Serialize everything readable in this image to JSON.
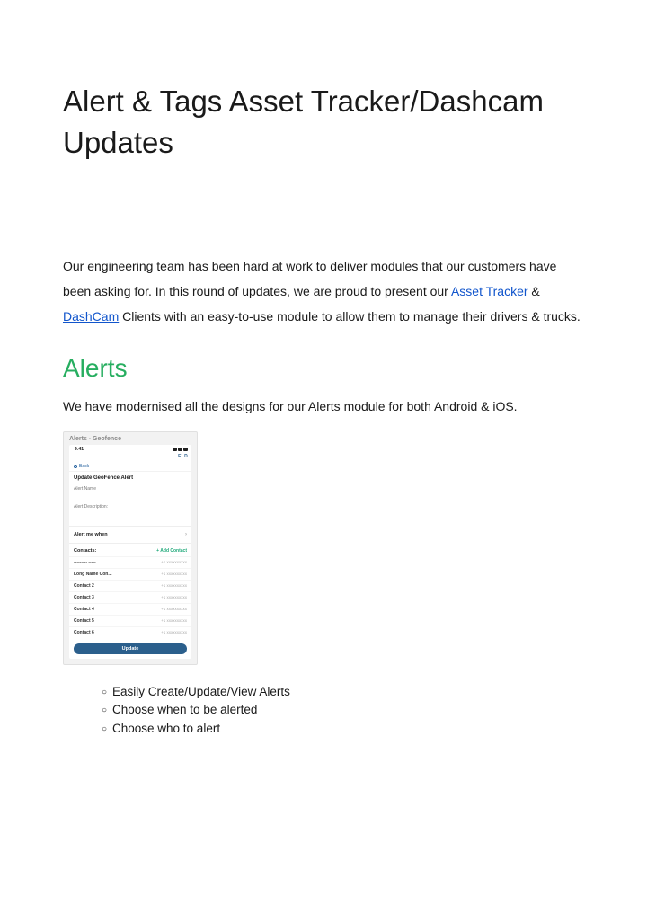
{
  "title": "Alert & Tags Asset Tracker/Dashcam Updates",
  "intro": {
    "part1": "Our engineering team has been hard at work to deliver modules that our customers have been asking for. In this round of updates, we are proud to present our",
    "link1": " Asset Tracker",
    "amp": " & ",
    "link2": "DashCam",
    "part2": " Clients with an easy-to-use module to allow them to manage their drivers & trucks."
  },
  "section": {
    "heading": "Alerts",
    "text": "We have modernised all the designs for our Alerts module for both Android & iOS."
  },
  "mockup": {
    "header": "Alerts - Geofence",
    "time": "9:41",
    "brand": "ELD",
    "back": "Back",
    "screen_title": "Update GeoFence Alert",
    "field_name": "Alert Name",
    "field_desc": "Alert Description:",
    "alert_me": "Alert me when",
    "contacts_label": "Contacts:",
    "add_contact": "+  Add Contact",
    "contacts": [
      {
        "name": "--------- -----",
        "num": "+1 xxxxxxxxxx"
      },
      {
        "name": "Long Name Con...",
        "num": "+1 xxxxxxxxxx"
      },
      {
        "name": "Contact 2",
        "num": "+1 xxxxxxxxxx"
      },
      {
        "name": "Contact 3",
        "num": "+1 xxxxxxxxxx"
      },
      {
        "name": "Contact 4",
        "num": "+1 xxxxxxxxxx"
      },
      {
        "name": "Contact 5",
        "num": "+1 xxxxxxxxxx"
      },
      {
        "name": "Contact 6",
        "num": "+1 xxxxxxxxxx"
      }
    ],
    "update_btn": "Update"
  },
  "bullets": [
    "Easily Create/Update/View Alerts",
    "Choose when to be alerted",
    "Choose who to alert"
  ]
}
